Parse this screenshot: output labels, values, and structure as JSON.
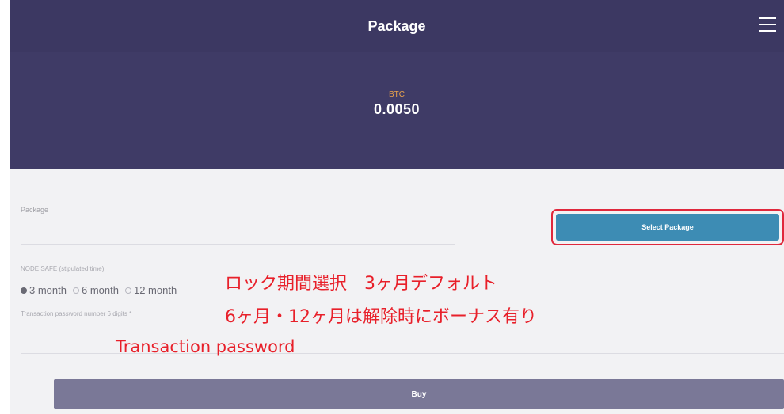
{
  "header": {
    "title": "Package"
  },
  "balance": {
    "currency": "BTC",
    "amount": "0.0050"
  },
  "form": {
    "package_label": "Package",
    "select_button_label": "Select Package",
    "node_safe_label": "NODE SAFE (stipulated time)",
    "radio_options": [
      {
        "label": "3 month",
        "checked": true
      },
      {
        "label": "6 month",
        "checked": false
      },
      {
        "label": "12 month",
        "checked": false
      }
    ],
    "tx_password_label": "Transaction password number 6 digits *",
    "buy_label": "Buy"
  },
  "annotations": {
    "line1": "ロック期間選択　3ヶ月デフォルト",
    "line2": "6ヶ月・12ヶ月は解除時にボーナス有り",
    "line3": "Transaction password"
  },
  "colors": {
    "header_bg": "#3c3862",
    "accent_blue": "#3d8cb4",
    "buy_bg": "#7a7897",
    "annotation": "#e8202a",
    "currency": "#e8a24c"
  },
  "icons": {
    "menu": "hamburger-menu-icon"
  }
}
